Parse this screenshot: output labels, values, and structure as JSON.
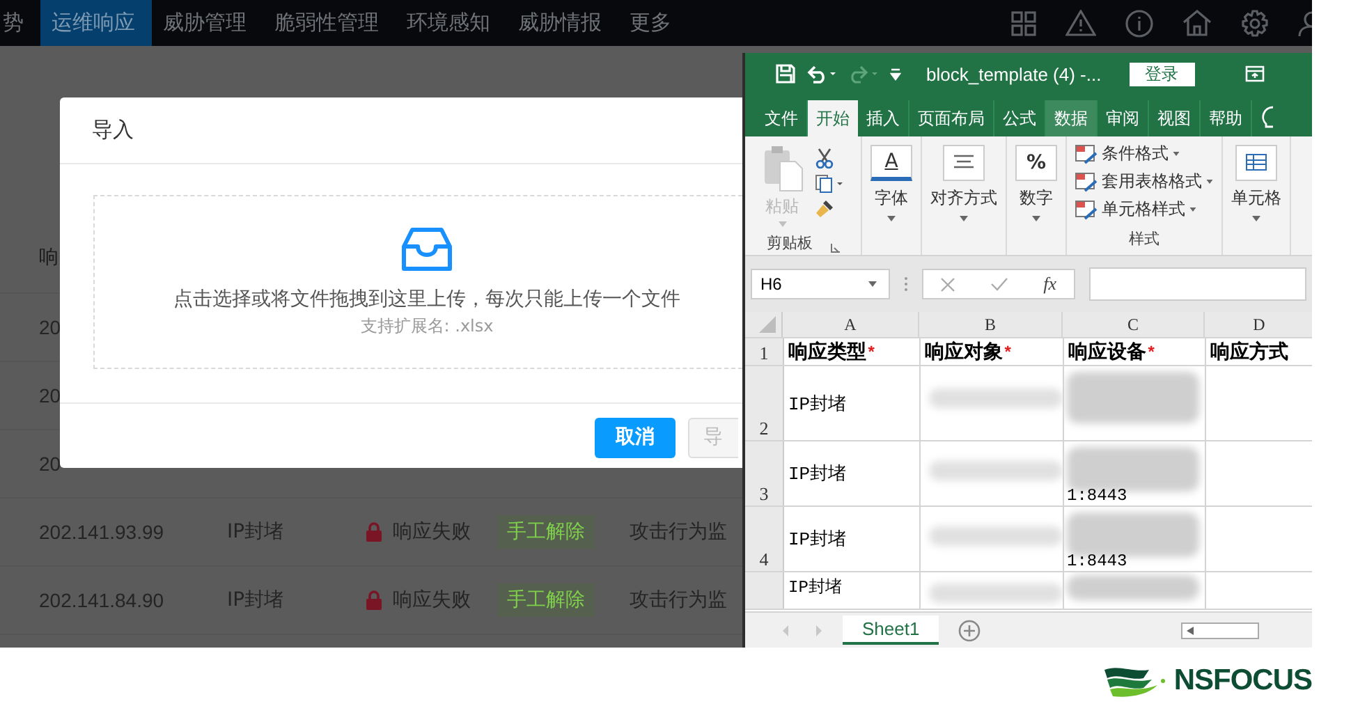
{
  "nav": {
    "items": [
      {
        "label": "势",
        "selected": false
      },
      {
        "label": "运维响应",
        "selected": true
      },
      {
        "label": "威胁管理",
        "selected": false
      },
      {
        "label": "脆弱性管理",
        "selected": false
      },
      {
        "label": "环境感知",
        "selected": false
      },
      {
        "label": "威胁情报",
        "selected": false
      },
      {
        "label": "更多",
        "selected": false
      }
    ]
  },
  "table": {
    "header": "响",
    "rows": [
      {
        "ip": "20"
      },
      {
        "ip": "20"
      },
      {
        "ip": "20"
      },
      {
        "ip": "202.141.93.99",
        "type": "IP封堵",
        "status": "响应失败",
        "tag": "手工解除",
        "source": "攻击行为监"
      },
      {
        "ip": "202.141.84.90",
        "type": "IP封堵",
        "status": "响应失败",
        "tag": "手工解除",
        "source": "攻击行为监"
      }
    ]
  },
  "modal": {
    "title": "导入",
    "upload": {
      "hint": "点击选择或将文件拖拽到这里上传，每次只能上传一个文件",
      "extensions": "支持扩展名: .xlsx"
    },
    "buttons": [
      {
        "label": "取消",
        "kind": "primary"
      },
      {
        "label": "导",
        "kind": "default"
      }
    ]
  },
  "excel": {
    "title": "block_template (4) -...",
    "login": "登录",
    "tabs": [
      {
        "label": "文件",
        "selected": false,
        "hovered": false
      },
      {
        "label": "开始",
        "selected": true,
        "hovered": false
      },
      {
        "label": "插入",
        "selected": false,
        "hovered": false
      },
      {
        "label": "页面布局",
        "selected": false,
        "hovered": false
      },
      {
        "label": "公式",
        "selected": false,
        "hovered": false
      },
      {
        "label": "数据",
        "selected": false,
        "hovered": true
      },
      {
        "label": "审阅",
        "selected": false,
        "hovered": false
      },
      {
        "label": "视图",
        "selected": false,
        "hovered": false
      },
      {
        "label": "帮助",
        "selected": false,
        "hovered": false
      }
    ],
    "ribbon": {
      "paste": "粘贴",
      "clipboard": "剪贴板",
      "font_glyph": "A",
      "font": "字体",
      "align": "对齐方式",
      "number_glyph": "%",
      "number": "数字",
      "styles": [
        "条件格式",
        "套用表格格式",
        "单元格样式"
      ],
      "styles_label": "样式",
      "cells": "单元格"
    },
    "name_box": "H6",
    "fx": "fx",
    "columns": [
      "A",
      "B",
      "C",
      "D"
    ],
    "rows": [
      {
        "number": "1",
        "cells": [
          {
            "kind": "header",
            "text": "响应类型",
            "mark": "*"
          },
          {
            "kind": "header",
            "text": "响应对象",
            "mark": "*"
          },
          {
            "kind": "header",
            "text": "响应设备",
            "mark": "*"
          },
          {
            "kind": "header",
            "text": "响应方式"
          }
        ]
      },
      {
        "number": "2",
        "cells": [
          {
            "kind": "text",
            "text": "IP封堵"
          },
          {
            "kind": "blurred"
          },
          {
            "kind": "blurred"
          },
          {
            "kind": "empty"
          }
        ]
      },
      {
        "number": "3",
        "cells": [
          {
            "kind": "text",
            "text": "IP封堵"
          },
          {
            "kind": "blurred"
          },
          {
            "kind": "blurred",
            "text": "1:8443"
          },
          {
            "kind": "empty"
          }
        ]
      },
      {
        "number": "4",
        "cells": [
          {
            "kind": "text",
            "text": "IP封堵"
          },
          {
            "kind": "blurred"
          },
          {
            "kind": "blurred",
            "text": "1:8443"
          },
          {
            "kind": "empty"
          }
        ]
      },
      {
        "number": "",
        "cells": [
          {
            "kind": "text",
            "text": "IP封堵"
          },
          {
            "kind": "blurred"
          },
          {
            "kind": "blurred"
          },
          {
            "kind": "empty"
          }
        ]
      }
    ],
    "sheets": [
      {
        "label": "Sheet1",
        "selected": true
      }
    ]
  },
  "logo": {
    "text": "NSFOCUS"
  }
}
